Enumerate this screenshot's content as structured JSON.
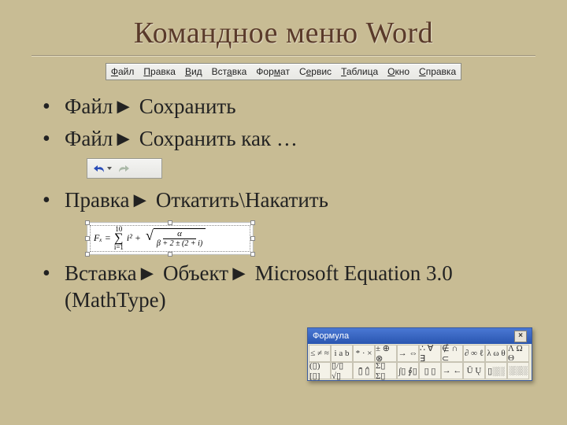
{
  "title": "Командное меню Word",
  "menubar": {
    "items": [
      "Файл",
      "Правка",
      "Вид",
      "Вставка",
      "Формат",
      "Сервис",
      "Таблица",
      "Окно",
      "Справка"
    ]
  },
  "bullets": {
    "b1": "Файл► Сохранить",
    "b2": "Файл► Сохранить как …",
    "b3": "Правка► Откатить\\Накатить",
    "b4": "Вставка► Объект► Microsoft Equation 3.0 (MathType)"
  },
  "equation": {
    "sum_upper": "10",
    "sum_lower": "i=1",
    "lhs": "Fₓ =",
    "term": "i² +",
    "sqrt_num": "α",
    "sqrt_den": "β + 2 ± (2 + i)"
  },
  "eq_toolbar": {
    "title": "Формула",
    "row1": [
      "≤ ≠ ≈",
      "i a b",
      "* · ×",
      "± ⊕ ⊗",
      "→ ⇔",
      "∴ ∀ ∃",
      "∉ ∩ ⊂",
      "∂ ∞ ℓ",
      "λ ω θ",
      "Λ Ω Θ"
    ],
    "row2": [
      "(▯) [▯]",
      "▯/▯ √▯",
      "▯̄ ▯̂",
      "Σ▯ Σ▯",
      "∫▯ ∮▯",
      "▯ ▯",
      "→ ←",
      "Ū Ų",
      "▯░░",
      "░░░"
    ]
  }
}
